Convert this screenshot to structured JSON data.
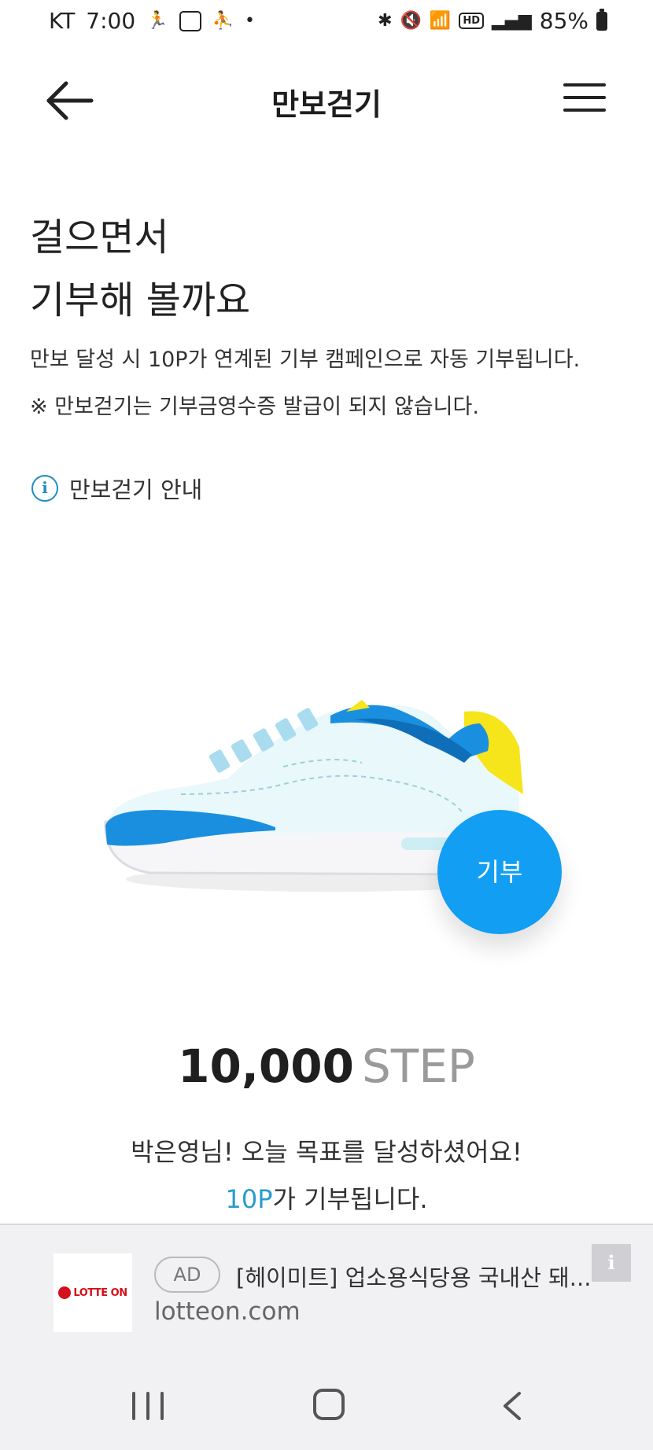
{
  "status_bar": {
    "carrier": "KT",
    "time": "7:00",
    "battery": "85%"
  },
  "header": {
    "title": "만보걷기"
  },
  "intro": {
    "headline_line1": "걸으면서",
    "headline_line2": "기부해 볼까요",
    "desc_line1": "만보 달성 시 10P가 연계된 기부 캠페인으로 자동 기부됩니다.",
    "desc_line2": "※ 만보걷기는 기부금영수증 발급이 되지 않습니다."
  },
  "guide": {
    "label": "만보걷기 안내"
  },
  "donate_button": {
    "label": "기부"
  },
  "steps": {
    "count": "10,000",
    "unit": "STEP"
  },
  "messages": {
    "achieve": "박은영님! 오늘 목표를 달성하셨어요!",
    "points": "10P",
    "points_suffix": "가 기부됩니다."
  },
  "ad": {
    "badge": "AD",
    "title": "[헤이미트] 업소용식당용 국내산 돼...",
    "domain": "lotteon.com",
    "brand": "LOTTE ON",
    "info_label": "i"
  },
  "colors": {
    "accent": "#129ef2",
    "points_highlight": "#2a9ccd",
    "shoe_blue": "#1a8fe0",
    "shoe_yellow": "#f5e51a"
  },
  "icons": {
    "back": "arrow-left-icon",
    "menu": "hamburger-icon",
    "info": "info-circle-icon"
  }
}
